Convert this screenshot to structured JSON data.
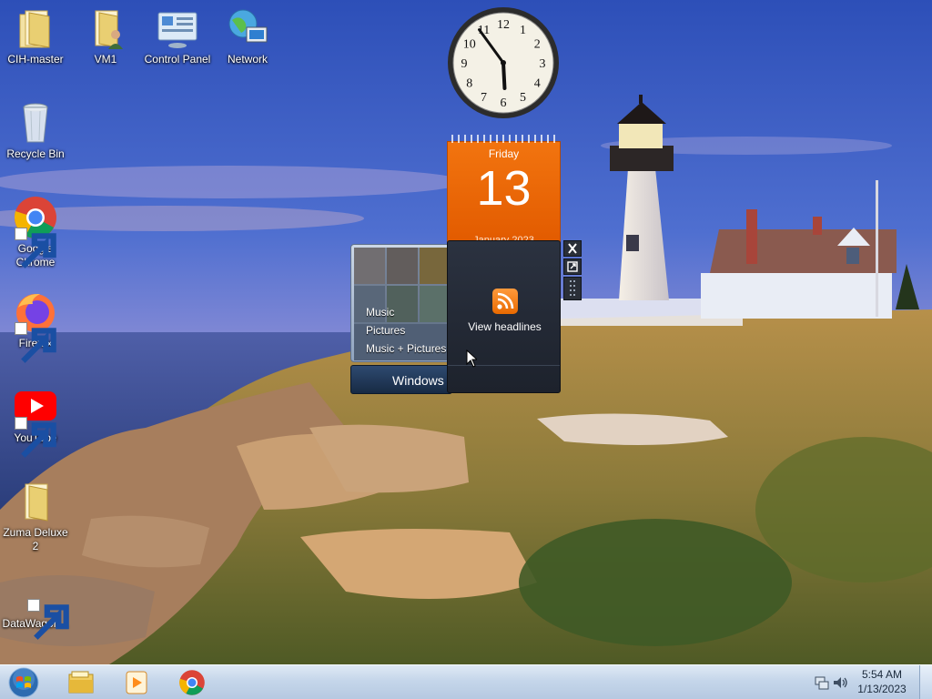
{
  "desktop": {
    "icons": [
      {
        "label": "CIH-master",
        "icon": "folder-icon"
      },
      {
        "label": "VM1",
        "icon": "user-folder-icon"
      },
      {
        "label": "Control Panel",
        "icon": "control-panel-icon"
      },
      {
        "label": "Network",
        "icon": "network-icon"
      },
      {
        "label": "Recycle Bin",
        "icon": "recycle-bin-icon"
      },
      {
        "label": "Google Chrome",
        "icon": "chrome-icon"
      },
      {
        "label": "Firefox",
        "icon": "firefox-icon"
      },
      {
        "label": "YouTube",
        "icon": "youtube-icon"
      },
      {
        "label": "Zuma Deluxe 2",
        "icon": "folder-icon"
      },
      {
        "label": "DataWagon...",
        "icon": "shortcut-icon"
      }
    ]
  },
  "gadgets": {
    "clock": {
      "hour": 5,
      "minute": 54,
      "numerals": [
        "12",
        "1",
        "2",
        "3",
        "4",
        "5",
        "6",
        "7",
        "8",
        "9",
        "10",
        "11"
      ]
    },
    "calendar": {
      "weekday": "Friday",
      "day": "13",
      "month_year": "January 2023"
    },
    "media": {
      "items": [
        "Music",
        "Pictures",
        "Music + Pictures"
      ],
      "brand": "Windows"
    },
    "feed": {
      "label": "View headlines"
    }
  },
  "taskbar": {
    "pinned": [
      "file-explorer-icon",
      "media-player-icon",
      "chrome-icon"
    ],
    "tray": {
      "time": "5:54 AM",
      "date": "1/13/2023"
    }
  },
  "colors": {
    "calendar_orange": "#e8650a",
    "taskbar": "#c5d6ea",
    "feed_bg": "#232934"
  }
}
